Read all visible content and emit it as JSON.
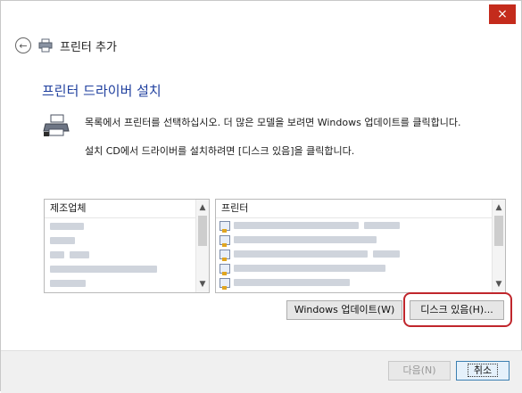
{
  "window": {
    "title": "프린터 추가",
    "close_glyph": "×",
    "back_glyph": "←"
  },
  "content": {
    "heading": "프린터 드라이버 설치",
    "line1": "목록에서 프린터를 선택하십시오. 더 많은 모델을 보려면 Windows 업데이트를 클릭합니다.",
    "line2": "설치 CD에서 드라이버를 설치하려면 [디스크 있음]을 클릭합니다."
  },
  "manufacturer_list": {
    "header": "제조업체"
  },
  "printer_list": {
    "header": "프린터"
  },
  "buttons": {
    "windows_update": "Windows 업데이트(W)",
    "have_disk": "디스크 있음(H)...",
    "next": "다음(N)",
    "cancel": "취소"
  },
  "colors": {
    "heading": "#1f3f9e",
    "close": "#c42b1c",
    "highlight_ring": "#c0262c"
  },
  "icons": [
    "back-arrow-icon",
    "printer-icon",
    "close-icon"
  ]
}
